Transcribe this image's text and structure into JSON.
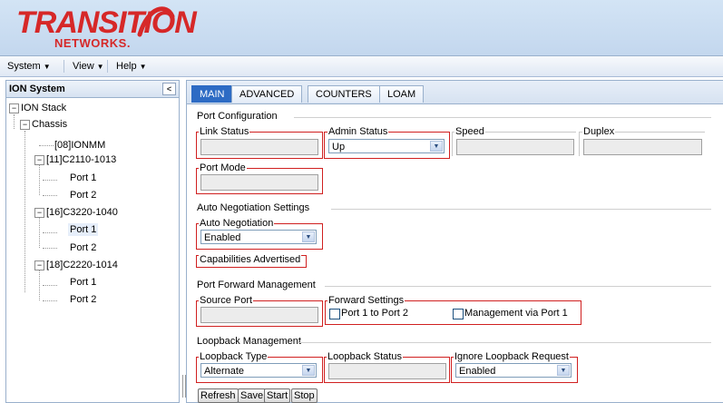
{
  "brand": {
    "logo_main": "TRANSITION",
    "logo_sub": "NETWORKS."
  },
  "menu": {
    "system": "System",
    "view": "View",
    "help": "Help"
  },
  "tree": {
    "title": "ION System",
    "collapse_glyph": "<",
    "nodes": [
      "ION Stack",
      "Chassis",
      "[08]IONMM",
      "[11]C2110-1013",
      "Port 1",
      "Port 2",
      "[16]C3220-1040",
      "Port 1",
      "Port 2",
      "[18]C2220-1014",
      "Port 1",
      "Port 2"
    ]
  },
  "tabs": [
    "MAIN",
    "ADVANCED",
    "COUNTERS",
    "LOAM"
  ],
  "port_config": {
    "title": "Port Configuration",
    "link_status_label": "Link Status",
    "admin_status_label": "Admin Status",
    "admin_status_value": "Up",
    "speed_label": "Speed",
    "duplex_label": "Duplex",
    "port_mode_label": "Port Mode"
  },
  "auto_neg": {
    "title": "Auto Negotiation Settings",
    "label": "Auto Negotiation",
    "value": "Enabled",
    "capabilities_label": "Capabilities Advertised"
  },
  "port_forward": {
    "title": "Port Forward Management",
    "source_port_label": "Source Port",
    "forward_settings_label": "Forward Settings",
    "port1_to_port2": "Port 1 to Port 2",
    "mgmt_via_port1": "Management via Port 1"
  },
  "loopback": {
    "title": "Loopback Management",
    "type_label": "Loopback Type",
    "type_value": "Alternate",
    "status_label": "Loopback Status",
    "ignore_label": "Ignore Loopback Request",
    "ignore_value": "Enabled"
  },
  "buttons": {
    "refresh": "Refresh",
    "save": "Save",
    "start": "Start",
    "stop": "Stop"
  },
  "colors": {
    "accent": "#2d6bc4",
    "brand_red": "#d62828",
    "group_border": "#d02020"
  }
}
